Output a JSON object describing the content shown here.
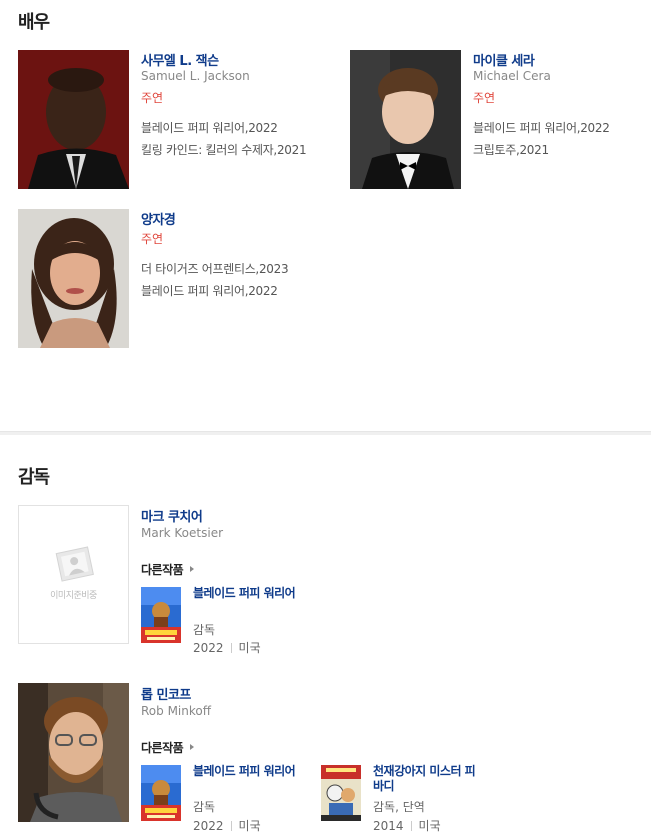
{
  "actors_section": {
    "title": "배우"
  },
  "actors": [
    {
      "name": "사무엘 L. 잭슨",
      "ename": "Samuel L. Jackson",
      "role": "주연",
      "works": [
        "블레이드 퍼피 워리어,2022",
        "킬링 카인드: 킬러의 수제자,2021"
      ]
    },
    {
      "name": "마이클 세라",
      "ename": "Michael Cera",
      "role": "주연",
      "works": [
        "블레이드 퍼피 워리어,2022",
        "크립토주,2021"
      ]
    },
    {
      "name": "양자경",
      "ename": "",
      "role": "주연",
      "works": [
        "더 타이거즈 어프렌티스,2023",
        "블레이드 퍼피 워리어,2022"
      ]
    }
  ],
  "directors_section": {
    "title": "감독"
  },
  "directors": [
    {
      "name": "마크 쿠치어",
      "ename": "Mark Koetsier",
      "no_image_label": "이미지준비중",
      "other_works_label": "다른작품",
      "works": [
        {
          "title": "블레이드 퍼피 워리어",
          "role": "감독",
          "year": "2022",
          "country": "미국"
        }
      ]
    },
    {
      "name": "롭 민코프",
      "ename": "Rob Minkoff",
      "other_works_label": "다른작품",
      "works": [
        {
          "title": "블레이드 퍼피 워리어",
          "role": "감독",
          "year": "2022",
          "country": "미국"
        },
        {
          "title": "천재강아지 미스터 피바디",
          "role": "감독, 단역",
          "year": "2014",
          "country": "미국"
        }
      ]
    }
  ]
}
